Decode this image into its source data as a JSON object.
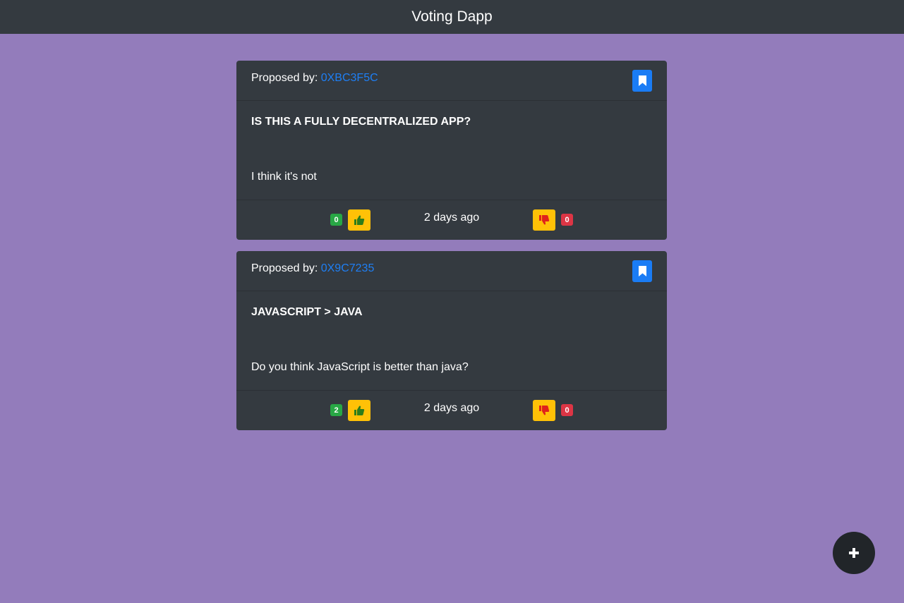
{
  "navbar": {
    "title": "Voting Dapp"
  },
  "proposals": [
    {
      "proposed_by_label": "Proposed by:",
      "address": "0XBC3F5C",
      "title": "IS THIS A FULLY DECENTRALIZED APP?",
      "description": "I think it's not",
      "upvotes": "0",
      "downvotes": "0",
      "time": "2 days ago"
    },
    {
      "proposed_by_label": "Proposed by:",
      "address": "0X9C7235",
      "title": "JAVASCRIPT > JAVA",
      "description": "Do you think JavaScript is better than java?",
      "upvotes": "2",
      "downvotes": "0",
      "time": "2 days ago"
    }
  ],
  "colors": {
    "background": "#937cbb",
    "navbar": "#343a40",
    "card": "#343a40",
    "link": "#1e7ff5",
    "bookmark": "#1a7cf5",
    "vote_button": "#ffc107",
    "upvote_badge": "#28a745",
    "downvote_badge": "#dc3545",
    "fab": "#212529"
  },
  "icons": {
    "bookmark": "bookmark-icon",
    "upvote": "thumbs-up-icon",
    "downvote": "thumbs-down-icon",
    "add": "plus-icon"
  }
}
